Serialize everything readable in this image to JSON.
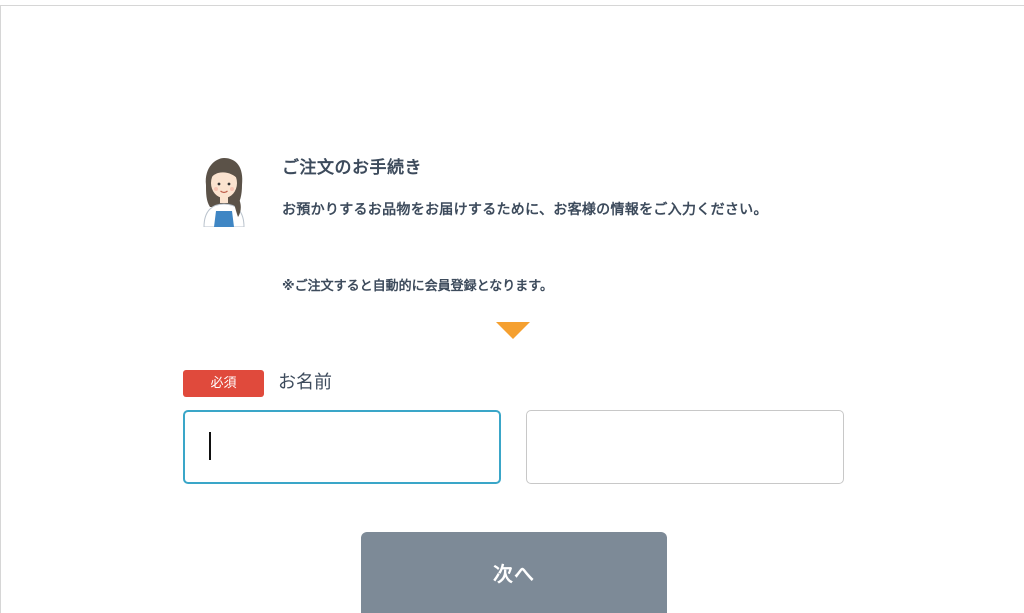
{
  "intro": {
    "title": "ご注文のお手続き",
    "body": "お預かりするお品物をお届けするために、お客様の情報をご入力ください。",
    "note": "※ご注文すると自動的に会員登録となります。"
  },
  "name_field": {
    "required_badge": "必須",
    "label": "お名前",
    "last_name_value": "",
    "first_name_value": ""
  },
  "actions": {
    "next_label": "次へ"
  },
  "colors": {
    "accent_arrow": "#f5a030",
    "required_badge": "#e04a3c",
    "focus_border": "#3aa6c8",
    "next_button": "#7d8a97",
    "text": "#3d4b5c"
  },
  "icons": {
    "avatar": "support-staff-avatar-icon",
    "arrow": "down-triangle-icon"
  }
}
